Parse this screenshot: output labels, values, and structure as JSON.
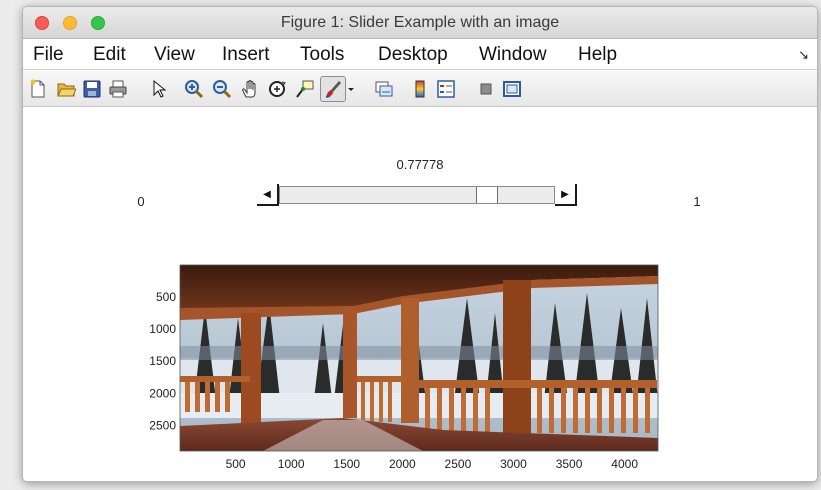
{
  "window": {
    "title": "Figure 1: Slider Example with an image"
  },
  "menu": {
    "items": [
      "File",
      "Edit",
      "View",
      "Insert",
      "Tools",
      "Desktop",
      "Window",
      "Help"
    ],
    "overflow_icon": "dock-arrow-icon"
  },
  "toolbar": {
    "icons": [
      "new-figure-icon",
      "open-file-icon",
      "save-icon",
      "print-icon",
      "pointer-icon",
      "zoom-in-icon",
      "zoom-out-icon",
      "pan-hand-icon",
      "rotate-3d-icon",
      "data-cursor-icon",
      "brush-icon",
      "brush-dropdown-icon",
      "link-plot-icon",
      "colorbar-icon",
      "legend-icon",
      "hide-plot-tools-icon",
      "show-plot-tools-icon"
    ]
  },
  "slider": {
    "value_text": "0.77778",
    "value": 0.77778,
    "min_label": "0",
    "max_label": "1",
    "min": 0,
    "max": 1
  },
  "image_axes": {
    "x_ticks": [
      "500",
      "1000",
      "1500",
      "2000",
      "2500",
      "3000",
      "3500",
      "4000"
    ],
    "y_ticks": [
      "500",
      "1000",
      "1500",
      "2000",
      "2500"
    ],
    "x_tick_values": [
      500,
      1000,
      1500,
      2000,
      2500,
      3000,
      3500,
      4000
    ],
    "y_tick_values": [
      500,
      1000,
      1500,
      2000,
      2500
    ],
    "x_range": [
      0,
      4300
    ],
    "y_range": [
      0,
      2900
    ],
    "image_subject": "wooden porch railing overlooking snowy forest"
  },
  "colors": {
    "wood": "#9c4a20",
    "wood_dark": "#5c2612",
    "sky": "#b9c8d6",
    "snow": "#dfe6ee",
    "trees": "#2a2c2c"
  }
}
